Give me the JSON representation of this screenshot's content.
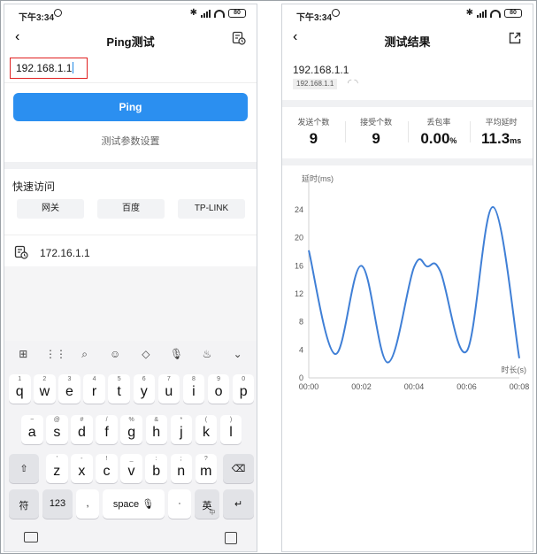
{
  "status": {
    "time": "下午3:34",
    "battery": "80"
  },
  "left": {
    "title": "Ping测试",
    "ip_value": "192.168.1.1",
    "ping_label": "Ping",
    "param_link": "测试参数设置",
    "quick_title": "快速访问",
    "quick_buttons": [
      "网关",
      "百度",
      "TP-LINK"
    ],
    "history_ip": "172.16.1.1"
  },
  "keyboard": {
    "row1": [
      [
        "1",
        "q"
      ],
      [
        "2",
        "w"
      ],
      [
        "3",
        "e"
      ],
      [
        "4",
        "r"
      ],
      [
        "5",
        "t"
      ],
      [
        "6",
        "y"
      ],
      [
        "7",
        "u"
      ],
      [
        "8",
        "i"
      ],
      [
        "9",
        "o"
      ],
      [
        "0",
        "p"
      ]
    ],
    "row2": [
      [
        "~",
        "a"
      ],
      [
        "@",
        "s"
      ],
      [
        "#",
        "d"
      ],
      [
        "/",
        "f"
      ],
      [
        "%",
        "g"
      ],
      [
        "&",
        "h"
      ],
      [
        "*",
        "j"
      ],
      [
        "(",
        "k"
      ],
      [
        ")",
        "l"
      ]
    ],
    "row3": [
      [
        "'",
        "z"
      ],
      [
        "-",
        "x"
      ],
      [
        "!",
        "c"
      ],
      [
        "_",
        "v"
      ],
      [
        ":",
        "b"
      ],
      [
        ";",
        "n"
      ],
      [
        "?",
        "m"
      ]
    ],
    "fu": "符",
    "num": "123",
    "space": "space",
    "dot_left": ",",
    "dot_right": "·",
    "lang": "英",
    "lang_sub": "中"
  },
  "right": {
    "title": "测试结果",
    "ip": "192.168.1.1",
    "ip_tag": "192.168.1.1",
    "stats": [
      {
        "label": "发送个数",
        "value": "9",
        "unit": ""
      },
      {
        "label": "接受个数",
        "value": "9",
        "unit": ""
      },
      {
        "label": "丢包率",
        "value": "0.00",
        "unit": "%"
      },
      {
        "label": "平均延时",
        "value": "11.3",
        "unit": "ms"
      }
    ]
  },
  "chart_data": {
    "type": "line",
    "ylabel": "延时(ms)",
    "xlabel": "时长(s)",
    "ylim": [
      0,
      24
    ],
    "yticks": [
      0,
      4,
      8,
      12,
      16,
      20,
      24
    ],
    "xticks": [
      "00:00",
      "00:02",
      "00:04",
      "00:06",
      "00:08"
    ],
    "xlim": [
      0,
      8
    ],
    "grid": false,
    "series": [
      {
        "color": "#3f7fd6",
        "x": [
          0,
          1,
          2,
          3,
          4,
          4.5,
          5,
          6,
          7,
          8
        ],
        "y": [
          18.2,
          3.4,
          16,
          2.2,
          15.8,
          15.9,
          15.2,
          3.8,
          24.4,
          2.8
        ]
      }
    ]
  }
}
